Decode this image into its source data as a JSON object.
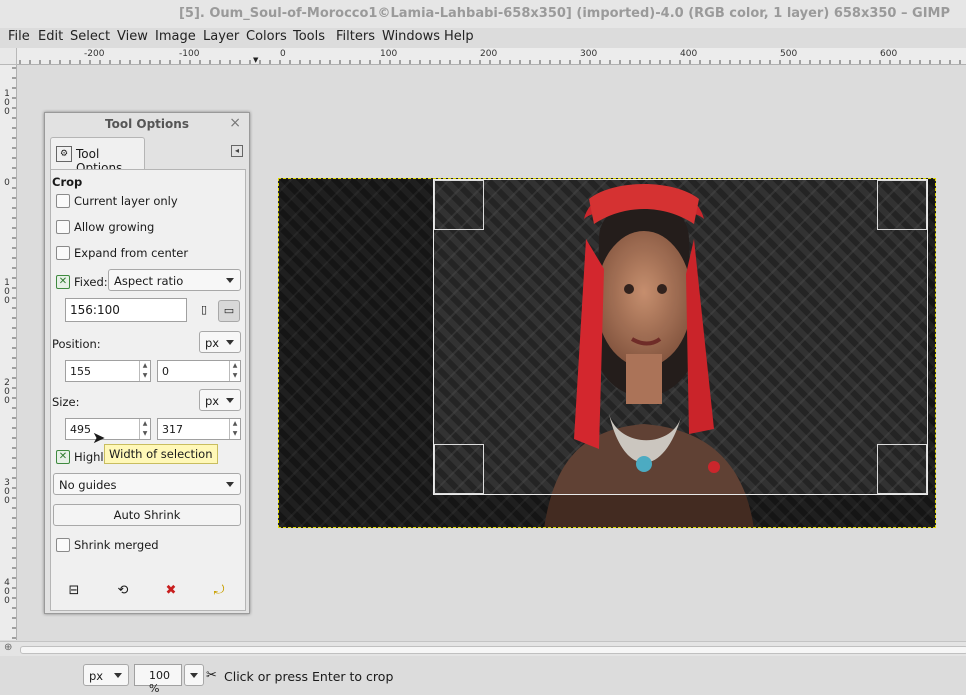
{
  "window": {
    "title": "[5]. Oum_Soul-of-Morocco1©Lamia-Lahbabi-658x350] (imported)-4.0 (RGB color, 1 layer) 658x350 – GIMP"
  },
  "menubar": {
    "items": [
      "File",
      "Edit",
      "Select",
      "View",
      "Image",
      "Layer",
      "Colors",
      "Tools",
      "Filters",
      "Windows",
      "Help"
    ]
  },
  "rulers": {
    "horizontal_labels": [
      "-200",
      "-100",
      "0",
      "100",
      "200",
      "300",
      "400",
      "500",
      "600"
    ],
    "vertical_labels": [
      "100",
      "0",
      "100",
      "200",
      "300",
      "400"
    ]
  },
  "dialog": {
    "title": "Tool Options",
    "close_icon": "close-icon",
    "tab_label": "Tool Options",
    "section_title": "Crop",
    "current_layer_only": {
      "label": "Current layer only",
      "checked": false
    },
    "allow_growing": {
      "label": "Allow growing",
      "checked": false
    },
    "expand_from_center": {
      "label": "Expand from center",
      "checked": false
    },
    "fixed": {
      "label": "Fixed:",
      "checked": true,
      "mode": "Aspect ratio"
    },
    "ratio_value": "156:100",
    "position": {
      "label": "Position:",
      "unit": "px",
      "x": "155",
      "y": "0"
    },
    "size": {
      "label": "Size:",
      "unit": "px",
      "w": "495",
      "h": "317"
    },
    "highlight": {
      "label": "Highli",
      "checked": true
    },
    "guides": "No guides",
    "auto_shrink": "Auto Shrink",
    "shrink_merged": {
      "label": "Shrink merged",
      "checked": false
    }
  },
  "tooltip": "Width of selection",
  "statusbar": {
    "unit": "px",
    "zoom": "100 %",
    "message": "Click or press Enter to crop"
  },
  "colors": {
    "tooltip_bg": "#fff8b8",
    "check_green": "#2f7a2f",
    "title_gray": "#9a9a9a"
  }
}
